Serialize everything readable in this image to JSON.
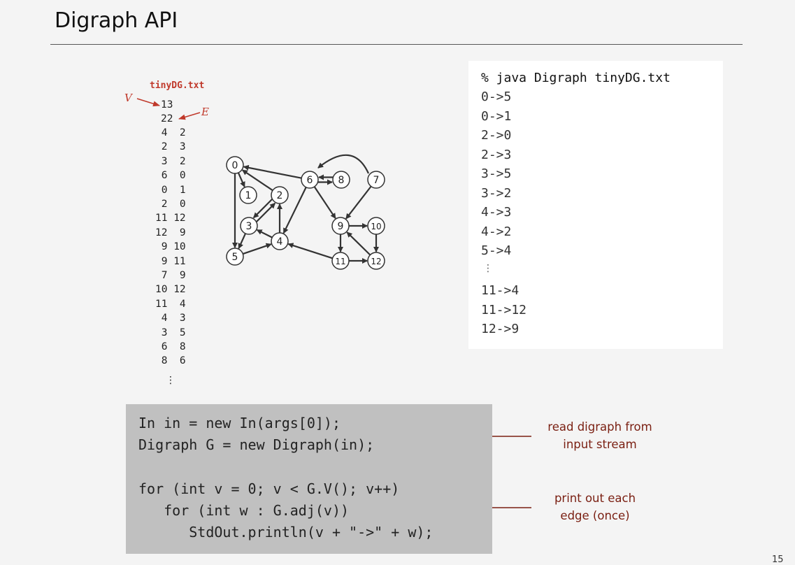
{
  "title": "Digraph API",
  "input_file": {
    "name": "tinyDG.txt",
    "v_label": "V",
    "e_label": "E",
    "vertex_count": "13",
    "edge_count": "22",
    "edges": [
      " 4  2",
      " 2  3",
      " 3  2",
      " 6  0",
      " 0  1",
      " 2  0",
      "11 12",
      "12  9",
      " 9 10",
      " 9 11",
      " 7  9",
      "10 12",
      "11  4",
      " 4  3",
      " 3  5",
      " 6  8",
      " 8  6"
    ],
    "ellipsis": "⋮"
  },
  "graph": {
    "vertices": [
      "0",
      "1",
      "2",
      "3",
      "4",
      "5",
      "6",
      "7",
      "8",
      "9",
      "10",
      "11",
      "12"
    ]
  },
  "output": {
    "command": "% java Digraph tinyDG.txt",
    "lines_top": [
      "0->5",
      "0->1",
      "2->0",
      "2->3",
      "3->5",
      "3->2",
      "4->3",
      "4->2",
      "5->4"
    ],
    "ellipsis": "⋮",
    "lines_bottom": [
      "11->4",
      "11->12",
      "12->9"
    ]
  },
  "code": {
    "lines": [
      "In in = new In(args[0]);",
      "Digraph G = new Digraph(in);",
      "",
      "for (int v = 0; v < G.V(); v++)",
      "   for (int w : G.adj(v))",
      "      StdOut.println(v + \"->\" + w);"
    ]
  },
  "annotations": {
    "read_note": [
      "read digraph from",
      "input stream"
    ],
    "print_note": [
      "print out each",
      "edge (once)"
    ]
  },
  "page_number": "15",
  "colors": {
    "red": "#c0392b",
    "dark_red": "#7a1f12",
    "code_bg": "#c0c0c0"
  }
}
